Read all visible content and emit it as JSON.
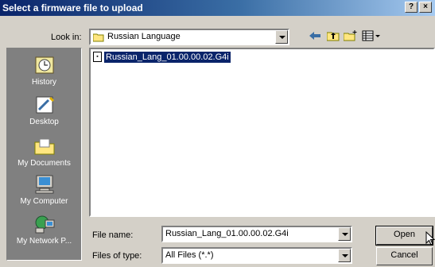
{
  "window": {
    "title": "Select a firmware file to upload",
    "help_label": "?",
    "close_label": "×"
  },
  "look_in": {
    "label": "Look in:",
    "value": "Russian Language"
  },
  "toolbar_icons": [
    "back-icon",
    "up-folder-icon",
    "new-folder-icon",
    "view-menu-icon"
  ],
  "places": [
    {
      "label": "History",
      "icon": "history-icon"
    },
    {
      "label": "Desktop",
      "icon": "desktop-icon"
    },
    {
      "label": "My Documents",
      "icon": "my-documents-icon"
    },
    {
      "label": "My Computer",
      "icon": "my-computer-icon"
    },
    {
      "label": "My Network P...",
      "icon": "my-network-icon"
    }
  ],
  "files": [
    {
      "name": "Russian_Lang_01.00.00.02.G4i",
      "selected": true
    }
  ],
  "file_name": {
    "label": "File name:",
    "value": "Russian_Lang_01.00.00.02.G4i"
  },
  "files_of_type": {
    "label": "Files of type:",
    "value": "All Files (*.*)"
  },
  "buttons": {
    "open": "Open",
    "cancel": "Cancel"
  }
}
